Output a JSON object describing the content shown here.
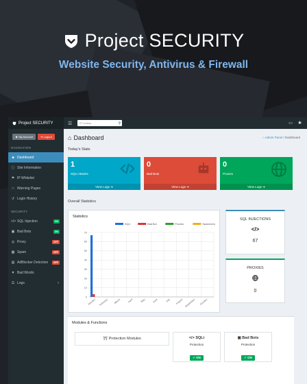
{
  "hero": {
    "title": "Project SECURITY",
    "subtitle": "Website Security, Antivirus & Firewall"
  },
  "brand": "Project SECURITY",
  "sidebar": {
    "account_btn": "My Account",
    "logout_btn": "Logout",
    "nav_header": "NAVIGATION",
    "nav": [
      {
        "label": "Dashboard",
        "icon": "dashboard-icon"
      },
      {
        "label": "Site Information",
        "icon": "info-icon"
      },
      {
        "label": "IP Whitelist",
        "icon": "flag-icon"
      },
      {
        "label": "Warning Pages",
        "icon": "file-icon"
      },
      {
        "label": "Login History",
        "icon": "history-icon"
      }
    ],
    "security_header": "SECURITY",
    "security": [
      {
        "label": "SQL Injection",
        "badge": "ON"
      },
      {
        "label": "Bad Bots",
        "badge": "ON"
      },
      {
        "label": "Proxy",
        "badge": "OFF"
      },
      {
        "label": "Spam",
        "badge": "OFF"
      },
      {
        "label": "AdBlocker Detection",
        "badge": "OFF"
      },
      {
        "label": "Bad Words",
        "badge": ""
      },
      {
        "label": "Logs",
        "badge": ""
      }
    ]
  },
  "topbar": {
    "search_placeholder": "IP Lookup"
  },
  "main": {
    "title": "Dashboard",
    "breadcrumb_home": "Admin Panel",
    "breadcrumb_sep": "/",
    "breadcrumb_current": "Dashboard",
    "todays_stats": "Today's Stats",
    "overall_stats": "Overall Statistics",
    "statistics_panel": "Statistics",
    "modules_title": "Modules & Functions"
  },
  "stat_boxes": [
    {
      "value": "1",
      "label": "SQLi Attacks",
      "footer": "View Logs",
      "color": "#00a7c8"
    },
    {
      "value": "0",
      "label": "Bad Bots",
      "footer": "View Logs",
      "color": "#dd4b39"
    },
    {
      "value": "0",
      "label": "Proxies",
      "footer": "View Logs",
      "color": "#00a65a"
    }
  ],
  "side_boxes": [
    {
      "title": "SQL INJECTIONS",
      "icon": "</>",
      "value": "67",
      "accent": "#3c8dbc"
    },
    {
      "title": "PROXIES",
      "icon": "globe-icon",
      "value": "0",
      "accent": "#00a65a"
    }
  ],
  "modules": {
    "protection_label": "Protection Modules",
    "cards": [
      {
        "title": "SQLi",
        "sub": "Protection",
        "status": "ON"
      },
      {
        "title": "Bad Bots",
        "sub": "Protection",
        "status": "ON"
      }
    ]
  },
  "chart_data": {
    "type": "bar",
    "title": "",
    "categories": [
      "January",
      "February",
      "March",
      "April",
      "May",
      "June",
      "July",
      "August",
      "September",
      "October"
    ],
    "series": [
      {
        "name": "SQLi",
        "color": "#1e6fd9",
        "values": [
          67,
          0,
          0,
          0,
          0,
          0,
          0,
          0,
          0,
          0
        ]
      },
      {
        "name": "Bad Bot",
        "color": "#dd3333",
        "values": [
          3,
          0,
          0,
          0,
          0,
          0,
          0,
          0,
          0,
          0
        ]
      },
      {
        "name": "Proxies",
        "color": "#2ca02c",
        "values": [
          0,
          0,
          0,
          0,
          0,
          0,
          0,
          0,
          0,
          0
        ]
      },
      {
        "name": "Spammers",
        "color": "#f0ad1e",
        "values": [
          0,
          0,
          0,
          0,
          0,
          0,
          0,
          0,
          0,
          0
        ]
      }
    ],
    "ylim": [
      0,
      70
    ],
    "yticks": [
      0,
      10,
      20,
      30,
      40,
      50,
      60,
      70
    ],
    "legend": "top",
    "grid": true
  }
}
